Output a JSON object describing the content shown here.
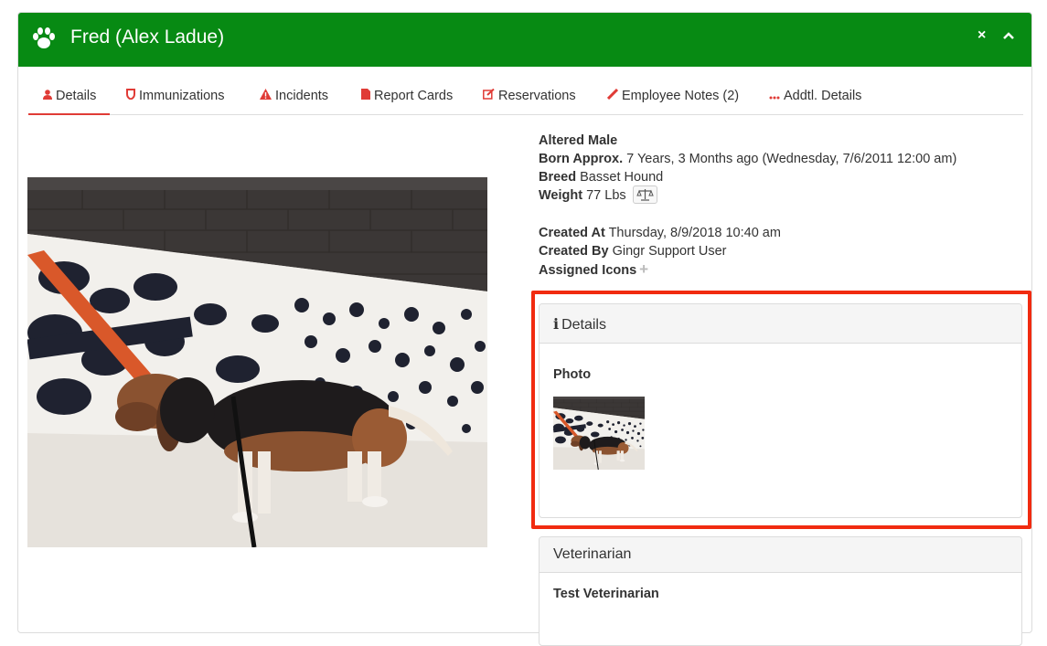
{
  "header": {
    "title": "Fred (Alex Ladue)",
    "close_label": "×",
    "collapse_label": "^"
  },
  "tabs": [
    {
      "label": "Details",
      "icon": "person-icon",
      "active": true
    },
    {
      "label": "Immunizations",
      "icon": "shield-icon"
    },
    {
      "label": "Incidents",
      "icon": "warning-icon"
    },
    {
      "label": "Report Cards",
      "icon": "file-icon"
    },
    {
      "label": "Reservations",
      "icon": "edit-icon"
    },
    {
      "label": "Employee Notes (2)",
      "icon": "pencil-icon"
    },
    {
      "label": "Addtl. Details",
      "icon": "ellipsis-icon"
    }
  ],
  "details": {
    "gender": "Altered Male",
    "born_label": "Born Approx.",
    "born_value": "7 Years, 3 Months ago (Wednesday, 7/6/2011 12:00 am)",
    "breed_label": "Breed",
    "breed_value": "Basset Hound",
    "weight_label": "Weight",
    "weight_value": "77 Lbs",
    "created_at_label": "Created At",
    "created_at_value": "Thursday, 8/9/2018 10:40 am",
    "created_by_label": "Created By",
    "created_by_value": "Gingr Support User",
    "assigned_icons_label": "Assigned Icons"
  },
  "details_card": {
    "title": "Details",
    "photo_label": "Photo"
  },
  "vet_card": {
    "title": "Veterinarian",
    "name": "Test Veterinarian"
  },
  "colors": {
    "header_green": "#078a13",
    "accent_red": "#e03b36",
    "highlight_red": "#f12b10"
  }
}
